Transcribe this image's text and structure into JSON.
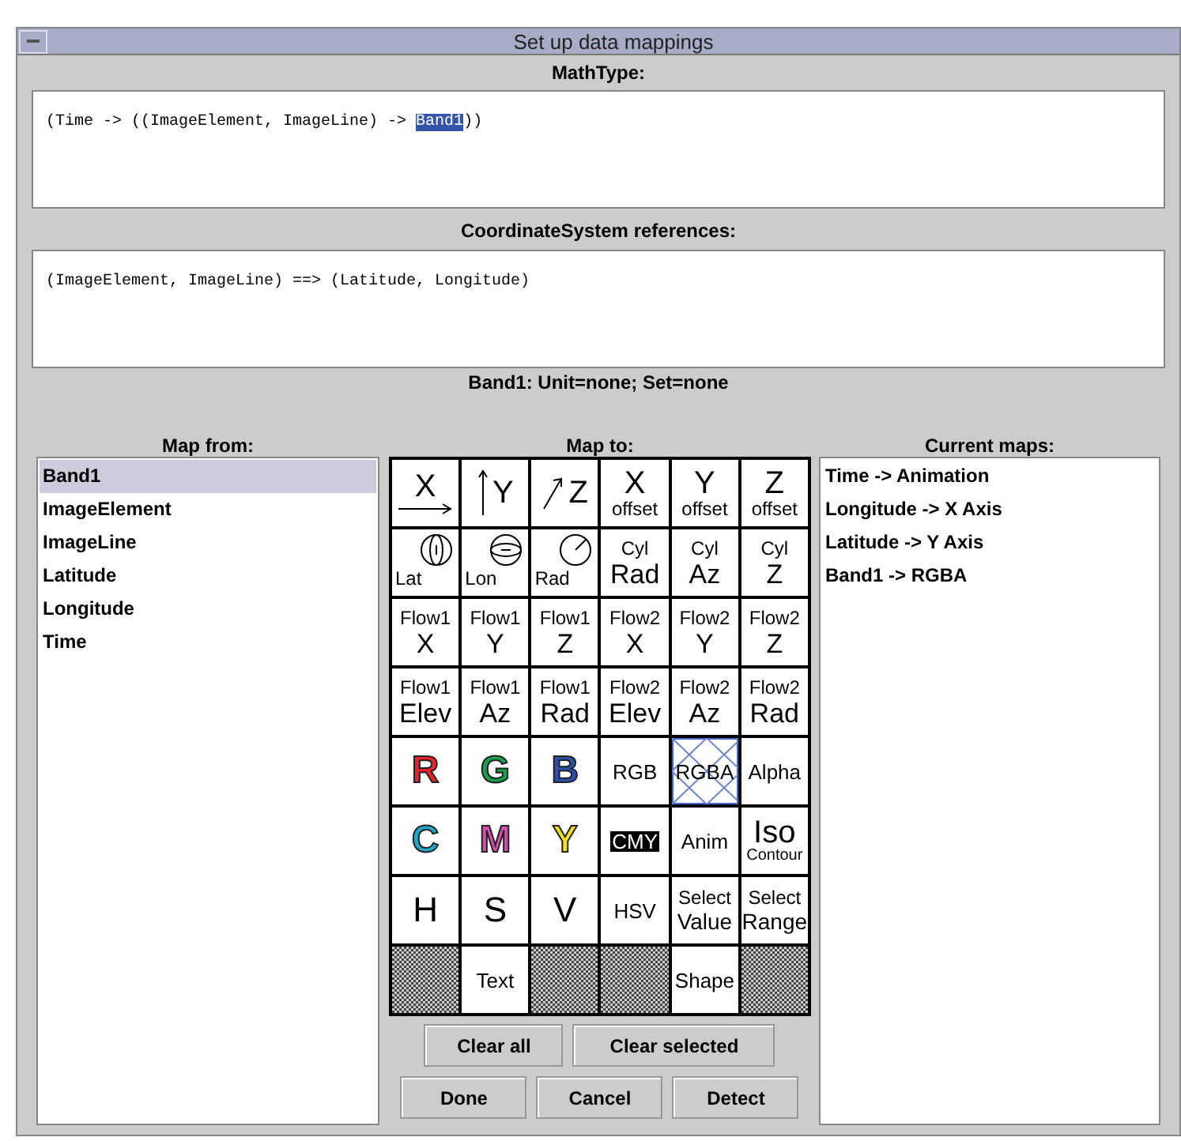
{
  "window": {
    "title": "Set up data mappings"
  },
  "math_type": {
    "label": "MathType:",
    "before": "(Time -> ((ImageElement, ImageLine) -> ",
    "selection": "Band1",
    "after": "))"
  },
  "coordinate_system": {
    "label": "CoordinateSystem references:",
    "text": "(ImageElement, ImageLine) ==> (Latitude, Longitude)"
  },
  "info": "Band1: Unit=none; Set=none",
  "map_from": {
    "label": "Map from:",
    "items": [
      {
        "text": "Band1",
        "selected": true
      },
      {
        "text": "ImageElement",
        "selected": false
      },
      {
        "text": "ImageLine",
        "selected": false
      },
      {
        "text": "Latitude",
        "selected": false
      },
      {
        "text": "Longitude",
        "selected": false
      },
      {
        "text": "Time",
        "selected": false
      }
    ]
  },
  "map_to": {
    "label": "Map to:",
    "cells": [
      {
        "kind": "axis_x",
        "text": "X",
        "selected": false
      },
      {
        "kind": "axis_y",
        "text": "Y",
        "selected": false
      },
      {
        "kind": "axis_z",
        "text": "Z",
        "selected": false
      },
      {
        "kind": "big_small",
        "top": "X",
        "bottom": "offset",
        "selected": false
      },
      {
        "kind": "big_small",
        "top": "Y",
        "bottom": "offset",
        "selected": false
      },
      {
        "kind": "big_small",
        "top": "Z",
        "bottom": "offset",
        "selected": false
      },
      {
        "kind": "lat",
        "text": "Lat",
        "selected": false
      },
      {
        "kind": "lon",
        "text": "Lon",
        "selected": false
      },
      {
        "kind": "rad",
        "text": "Rad",
        "selected": false
      },
      {
        "kind": "small_big",
        "top": "Cyl",
        "bottom": "Rad",
        "selected": false
      },
      {
        "kind": "small_big",
        "top": "Cyl",
        "bottom": "Az",
        "selected": false
      },
      {
        "kind": "small_big",
        "top": "Cyl",
        "bottom": "Z",
        "selected": false
      },
      {
        "kind": "small_big",
        "top": "Flow1",
        "bottom": "X",
        "selected": false
      },
      {
        "kind": "small_big",
        "top": "Flow1",
        "bottom": "Y",
        "selected": false
      },
      {
        "kind": "small_big",
        "top": "Flow1",
        "bottom": "Z",
        "selected": false
      },
      {
        "kind": "small_big",
        "top": "Flow2",
        "bottom": "X",
        "selected": false
      },
      {
        "kind": "small_big",
        "top": "Flow2",
        "bottom": "Y",
        "selected": false
      },
      {
        "kind": "small_big",
        "top": "Flow2",
        "bottom": "Z",
        "selected": false
      },
      {
        "kind": "small_big",
        "top": "Flow1",
        "bottom": "Elev",
        "selected": false
      },
      {
        "kind": "small_big",
        "top": "Flow1",
        "bottom": "Az",
        "selected": false
      },
      {
        "kind": "small_big",
        "top": "Flow1",
        "bottom": "Rad",
        "selected": false
      },
      {
        "kind": "small_big",
        "top": "Flow2",
        "bottom": "Elev",
        "selected": false
      },
      {
        "kind": "small_big",
        "top": "Flow2",
        "bottom": "Az",
        "selected": false
      },
      {
        "kind": "small_big",
        "top": "Flow2",
        "bottom": "Rad",
        "selected": false
      },
      {
        "kind": "color_letter",
        "text": "R",
        "color": "#e8202a",
        "selected": false
      },
      {
        "kind": "color_letter",
        "text": "G",
        "color": "#16a04a",
        "selected": false
      },
      {
        "kind": "color_letter",
        "text": "B",
        "color": "#2e4fa8",
        "selected": false
      },
      {
        "kind": "plain",
        "text": "RGB",
        "selected": false
      },
      {
        "kind": "plain",
        "text": "RGBA",
        "selected": true
      },
      {
        "kind": "plain",
        "text": "Alpha",
        "selected": false
      },
      {
        "kind": "color_letter",
        "text": "C",
        "color": "#1fa8c8",
        "selected": false
      },
      {
        "kind": "color_letter",
        "text": "M",
        "color": "#d050b0",
        "selected": false
      },
      {
        "kind": "color_letter",
        "text": "Y",
        "color": "#f0e020",
        "selected": false
      },
      {
        "kind": "inverse",
        "text": "CMY",
        "selected": false
      },
      {
        "kind": "plain",
        "text": "Anim",
        "selected": false
      },
      {
        "kind": "big_small",
        "top": "Iso",
        "bottom": "Contour",
        "selected": false
      },
      {
        "kind": "large",
        "text": "H",
        "selected": false
      },
      {
        "kind": "large",
        "text": "S",
        "selected": false
      },
      {
        "kind": "large",
        "text": "V",
        "selected": false
      },
      {
        "kind": "plain",
        "text": "HSV",
        "selected": false
      },
      {
        "kind": "small_big",
        "top": "Select",
        "bottom": "Value",
        "selected": false
      },
      {
        "kind": "small_big",
        "top": "Select",
        "bottom": "Range",
        "selected": false
      },
      {
        "kind": "empty",
        "selected": false
      },
      {
        "kind": "plain",
        "text": "Text",
        "selected": false
      },
      {
        "kind": "empty",
        "selected": false
      },
      {
        "kind": "empty",
        "selected": false
      },
      {
        "kind": "plain",
        "text": "Shape",
        "selected": false
      },
      {
        "kind": "empty",
        "selected": false
      }
    ],
    "buttons": [
      "Clear all",
      "Clear selected"
    ]
  },
  "current_maps": {
    "label": "Current maps:",
    "items": [
      "Time -> Animation",
      "Longitude -> X Axis",
      "Latitude -> Y Axis",
      "Band1 -> RGBA"
    ]
  },
  "buttons": [
    "Done",
    "Cancel",
    "Detect"
  ]
}
